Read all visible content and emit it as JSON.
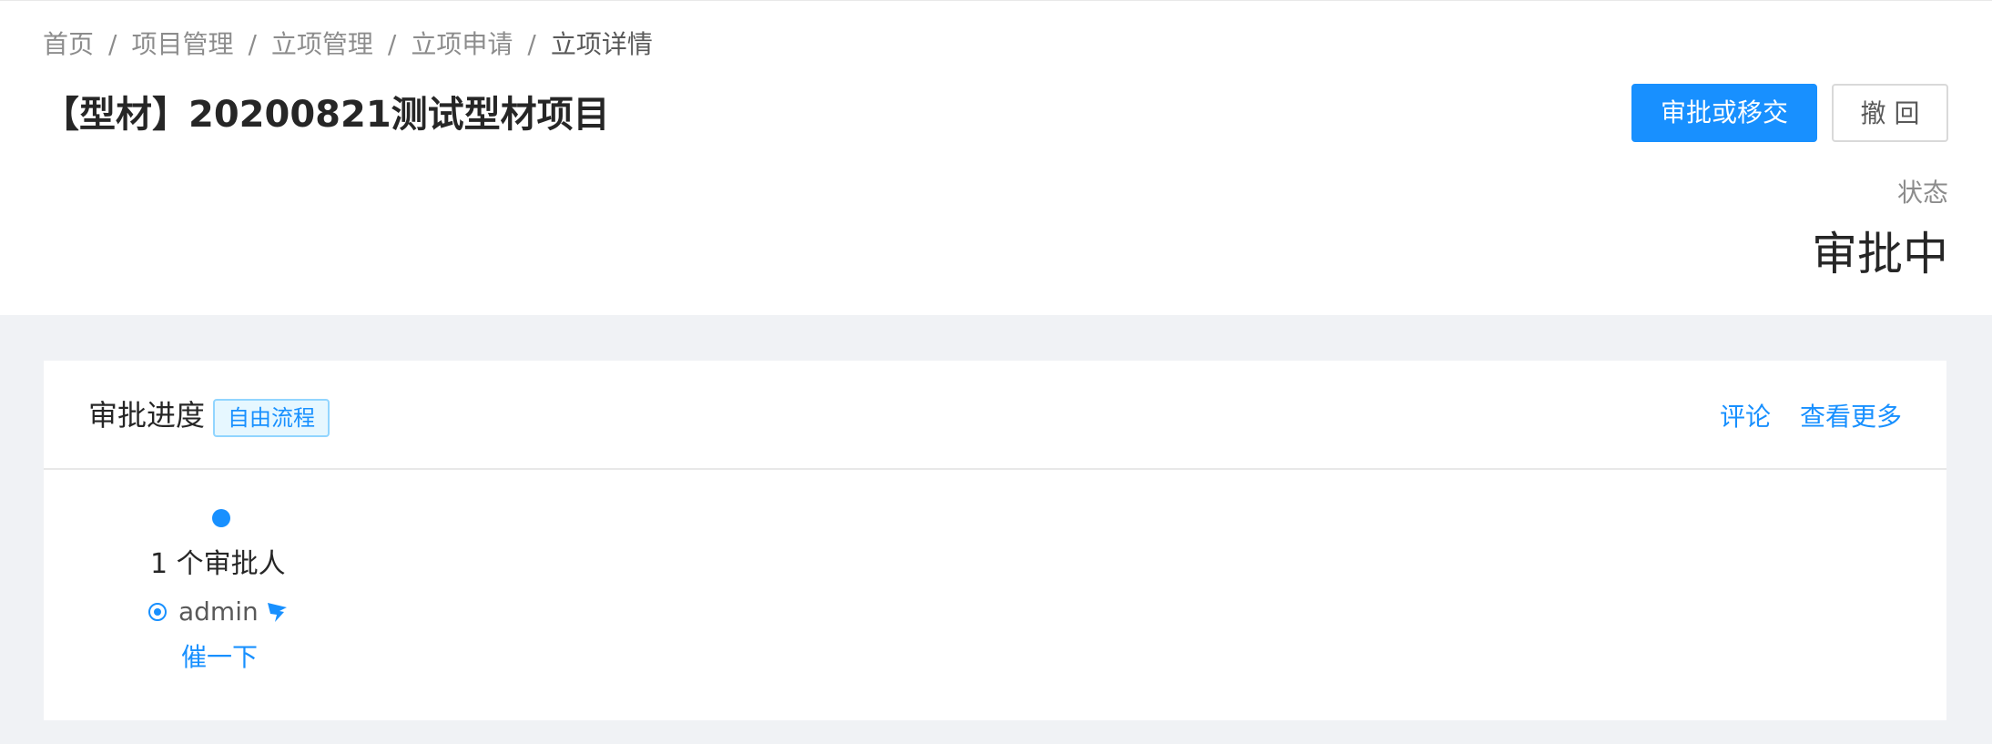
{
  "breadcrumb": {
    "items": [
      "首页",
      "项目管理",
      "立项管理",
      "立项申请",
      "立项详情"
    ],
    "separator": "/"
  },
  "header": {
    "title": "【型材】20200821测试型材项目",
    "actions": {
      "approve_label": "审批或移交",
      "withdraw_label": "撤 回"
    },
    "status": {
      "label": "状态",
      "value": "审批中"
    }
  },
  "approval_card": {
    "title": "审批进度",
    "tag": "自由流程",
    "links": {
      "comment": "评论",
      "more": "查看更多"
    },
    "step": {
      "approver_count": "1 个审批人",
      "approver_name": "admin",
      "approver_icon": "dingtalk-icon",
      "urge_label": "催一下"
    }
  },
  "colors": {
    "primary": "#1890ff",
    "background": "#f0f2f5",
    "tag_background": "#e6f7ff",
    "tag_border": "#91d5ff"
  }
}
